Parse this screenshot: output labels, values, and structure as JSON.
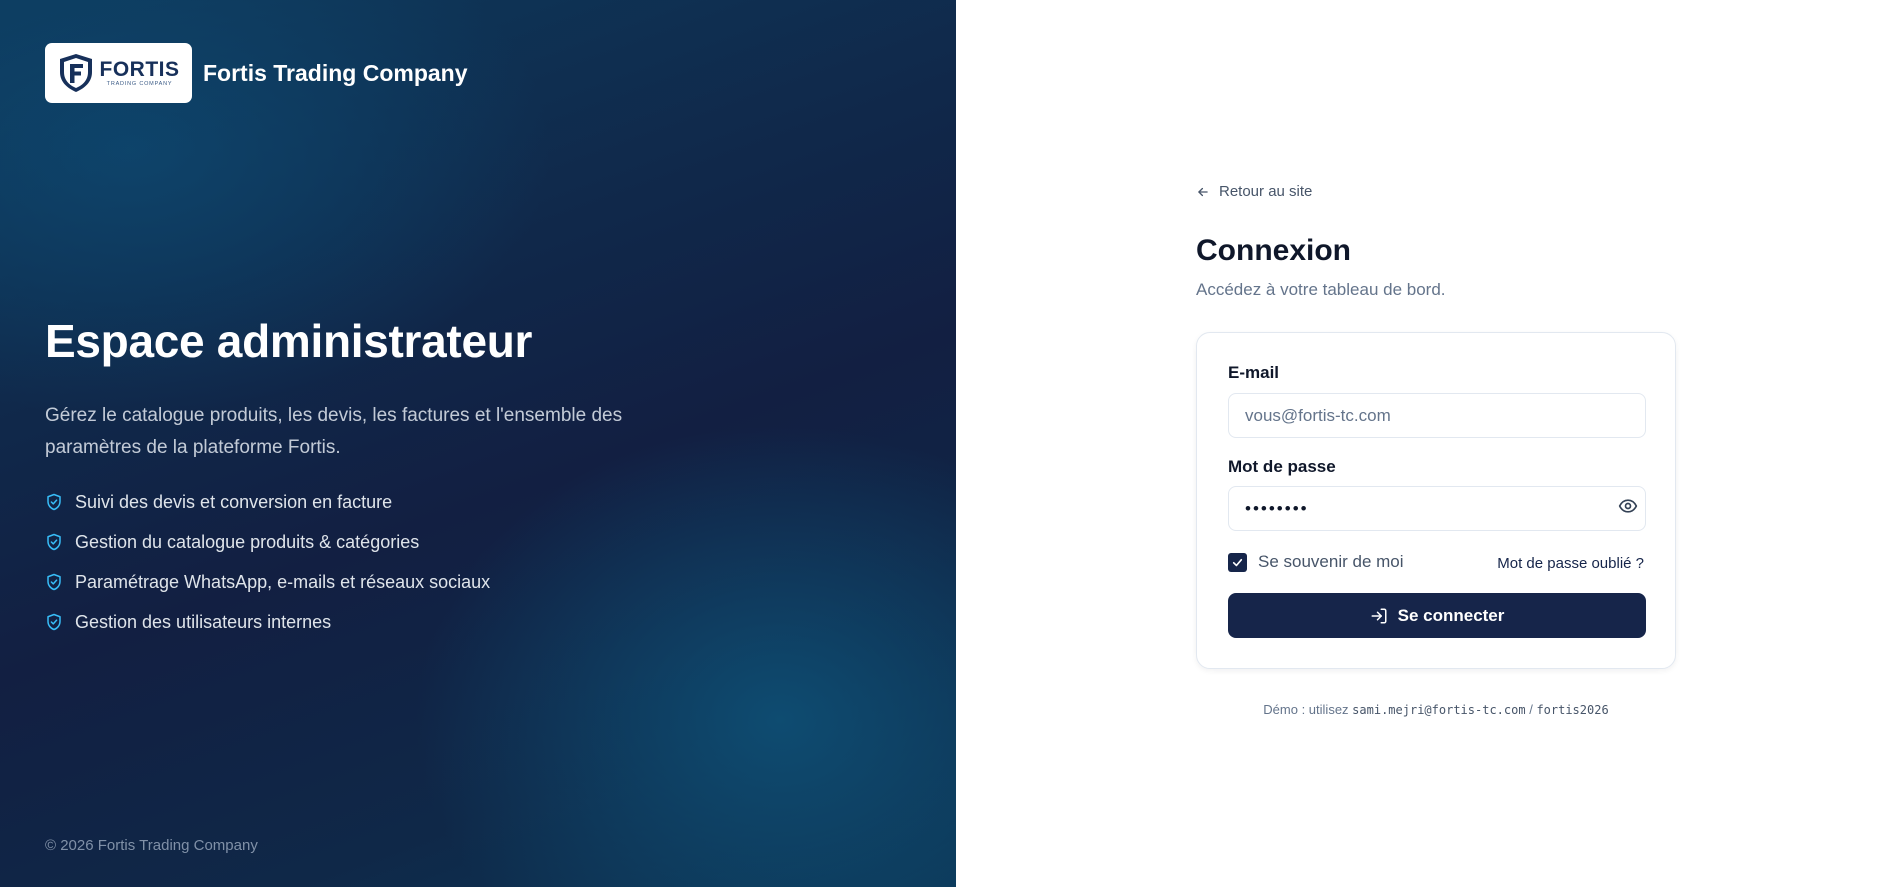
{
  "brand": {
    "logo_text": "FORTIS",
    "logo_tagline": "TRADING COMPANY",
    "name": "Fortis Trading Company"
  },
  "hero": {
    "title": "Espace administrateur",
    "description": "Gérez le catalogue produits, les devis, les factures et l'ensemble des paramètres de la plateforme Fortis.",
    "features": [
      "Suivi des devis et conversion en facture",
      "Gestion du catalogue produits & catégories",
      "Paramétrage WhatsApp, e-mails et réseaux sociaux",
      "Gestion des utilisateurs internes"
    ]
  },
  "footer": {
    "copyright": "© 2026 Fortis Trading Company"
  },
  "login": {
    "back_link": "Retour au site",
    "title": "Connexion",
    "subtitle": "Accédez à votre tableau de bord.",
    "email_label": "E-mail",
    "email_placeholder": "vous@fortis-tc.com",
    "password_label": "Mot de passe",
    "password_value": "••••••••",
    "remember_label": "Se souvenir de moi",
    "remember_checked": true,
    "forgot_link": "Mot de passe oublié ?",
    "submit_label": "Se connecter",
    "demo_prefix": "Démo : utilisez",
    "demo_email": "sami.mejri@fortis-tc.com",
    "demo_separator": "/",
    "demo_password": "fortis2026"
  },
  "icons": {
    "logo": "shield-f-icon",
    "feature": "shield-check-icon",
    "back": "arrow-left-icon",
    "password_toggle": "eye-icon",
    "checkbox": "check-icon",
    "submit": "log-in-icon"
  },
  "colors": {
    "accent": "#16254a",
    "feature_icon": "#38bdf8",
    "panel_dark": "#121f42"
  }
}
